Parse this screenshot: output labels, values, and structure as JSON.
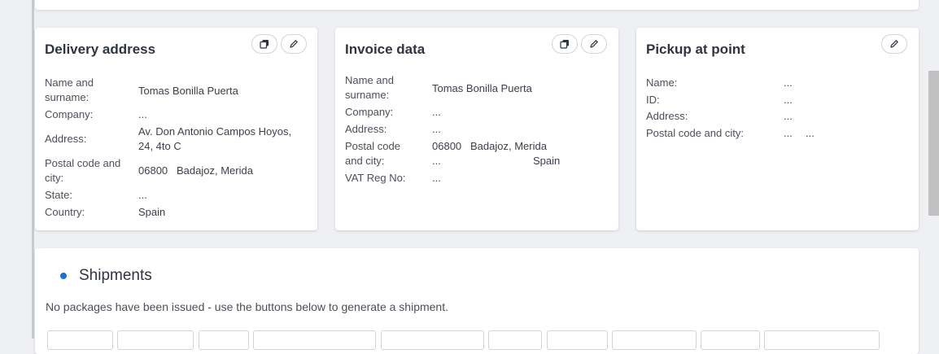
{
  "delivery": {
    "title": "Delivery address",
    "labels": {
      "name": "Name and surname:",
      "company": "Company:",
      "address": "Address:",
      "postal": "Postal code and city:",
      "state": "State:",
      "country": "Country:"
    },
    "values": {
      "name": "Tomas Bonilla Puerta",
      "company": "...",
      "address": "Av. Don Antonio Campos Hoyos, 24, 4to C",
      "postal": "06800   Badajoz, Merida",
      "state": "...",
      "country": "Spain"
    }
  },
  "invoice": {
    "title": "Invoice data",
    "labels": {
      "name": "Name and surname:",
      "company": "Company:",
      "address": "Address:",
      "postal": "Postal code and city:",
      "vat": "VAT Reg No:"
    },
    "values": {
      "name": "Tomas Bonilla Puerta",
      "company": "...",
      "address": "...",
      "postal_code": "06800",
      "city": "Badajoz, Merida",
      "postal_extra": "...",
      "country": "Spain",
      "vat": "..."
    }
  },
  "pickup": {
    "title": "Pickup at point",
    "labels": {
      "name": "Name:",
      "id": "ID:",
      "address": "Address:",
      "postal": "Postal code and city:"
    },
    "values": {
      "name": "...",
      "id": "...",
      "address": "...",
      "postal_code": "...",
      "city": "..."
    }
  },
  "shipments": {
    "title": "Shipments",
    "message": "No packages have been issued - use the buttons below to generate a shipment."
  },
  "icons": {
    "copy": "copy-icon",
    "edit": "pencil-icon"
  },
  "colors": {
    "accent": "#1a73c9"
  }
}
